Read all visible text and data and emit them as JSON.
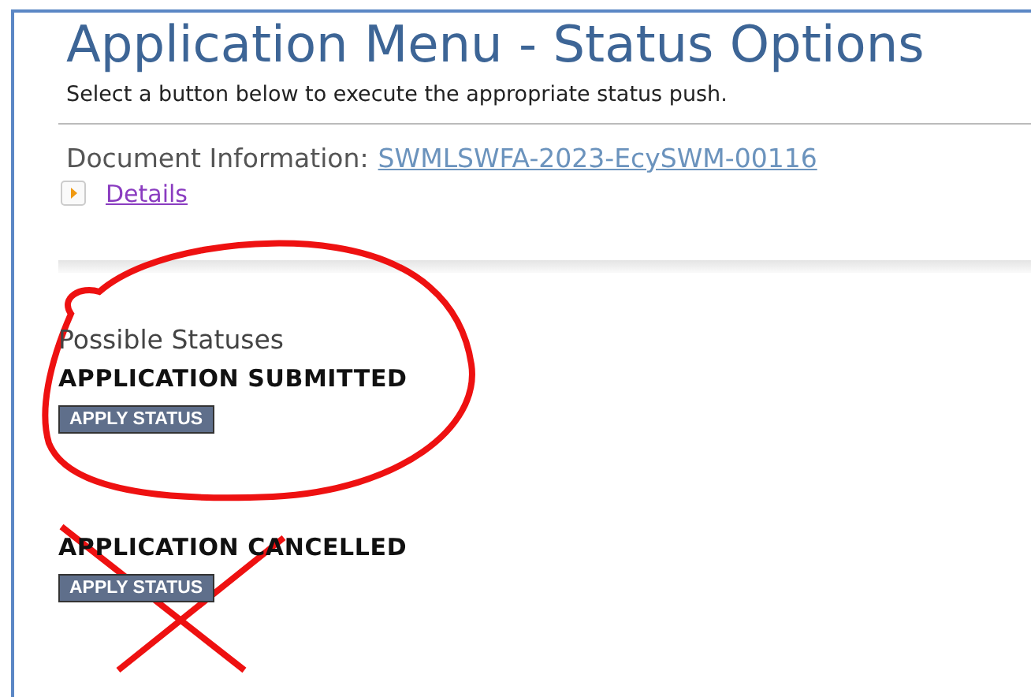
{
  "page": {
    "title": "Application Menu - Status Options",
    "instructions": "Select a button below to execute the appropriate status push."
  },
  "document": {
    "label": "Document Information:",
    "link": "SWMLSWFA-2023-EcySWM-00116",
    "details": "Details",
    "details_expanded": false
  },
  "statuses_heading": "Possible Statuses",
  "statuses": [
    {
      "name": "APPLICATION SUBMITTED",
      "button": "APPLY STATUS",
      "circled": true,
      "crossed": false
    },
    {
      "name": "APPLICATION CANCELLED",
      "button": "APPLY STATUS",
      "circled": false,
      "crossed": true
    }
  ]
}
